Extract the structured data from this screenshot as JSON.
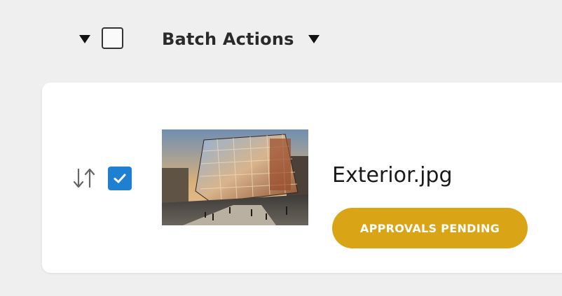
{
  "toolbar": {
    "select_all_caret_icon": "caret-down-icon",
    "select_all_checked": false,
    "batch_actions_label": "Batch Actions",
    "batch_actions_caret_icon": "caret-down-icon"
  },
  "file_row": {
    "reorder_icon": "sort-arrows-icon",
    "checked": true,
    "thumbnail_icon": "building-exterior-thumbnail",
    "filename": "Exterior.jpg",
    "status_label": "APPROVALS PENDING",
    "status_color": "#d9a516"
  },
  "colors": {
    "background": "#efefef",
    "card": "#ffffff",
    "checkbox_checked": "#1f7fd0",
    "badge": "#d9a516"
  }
}
